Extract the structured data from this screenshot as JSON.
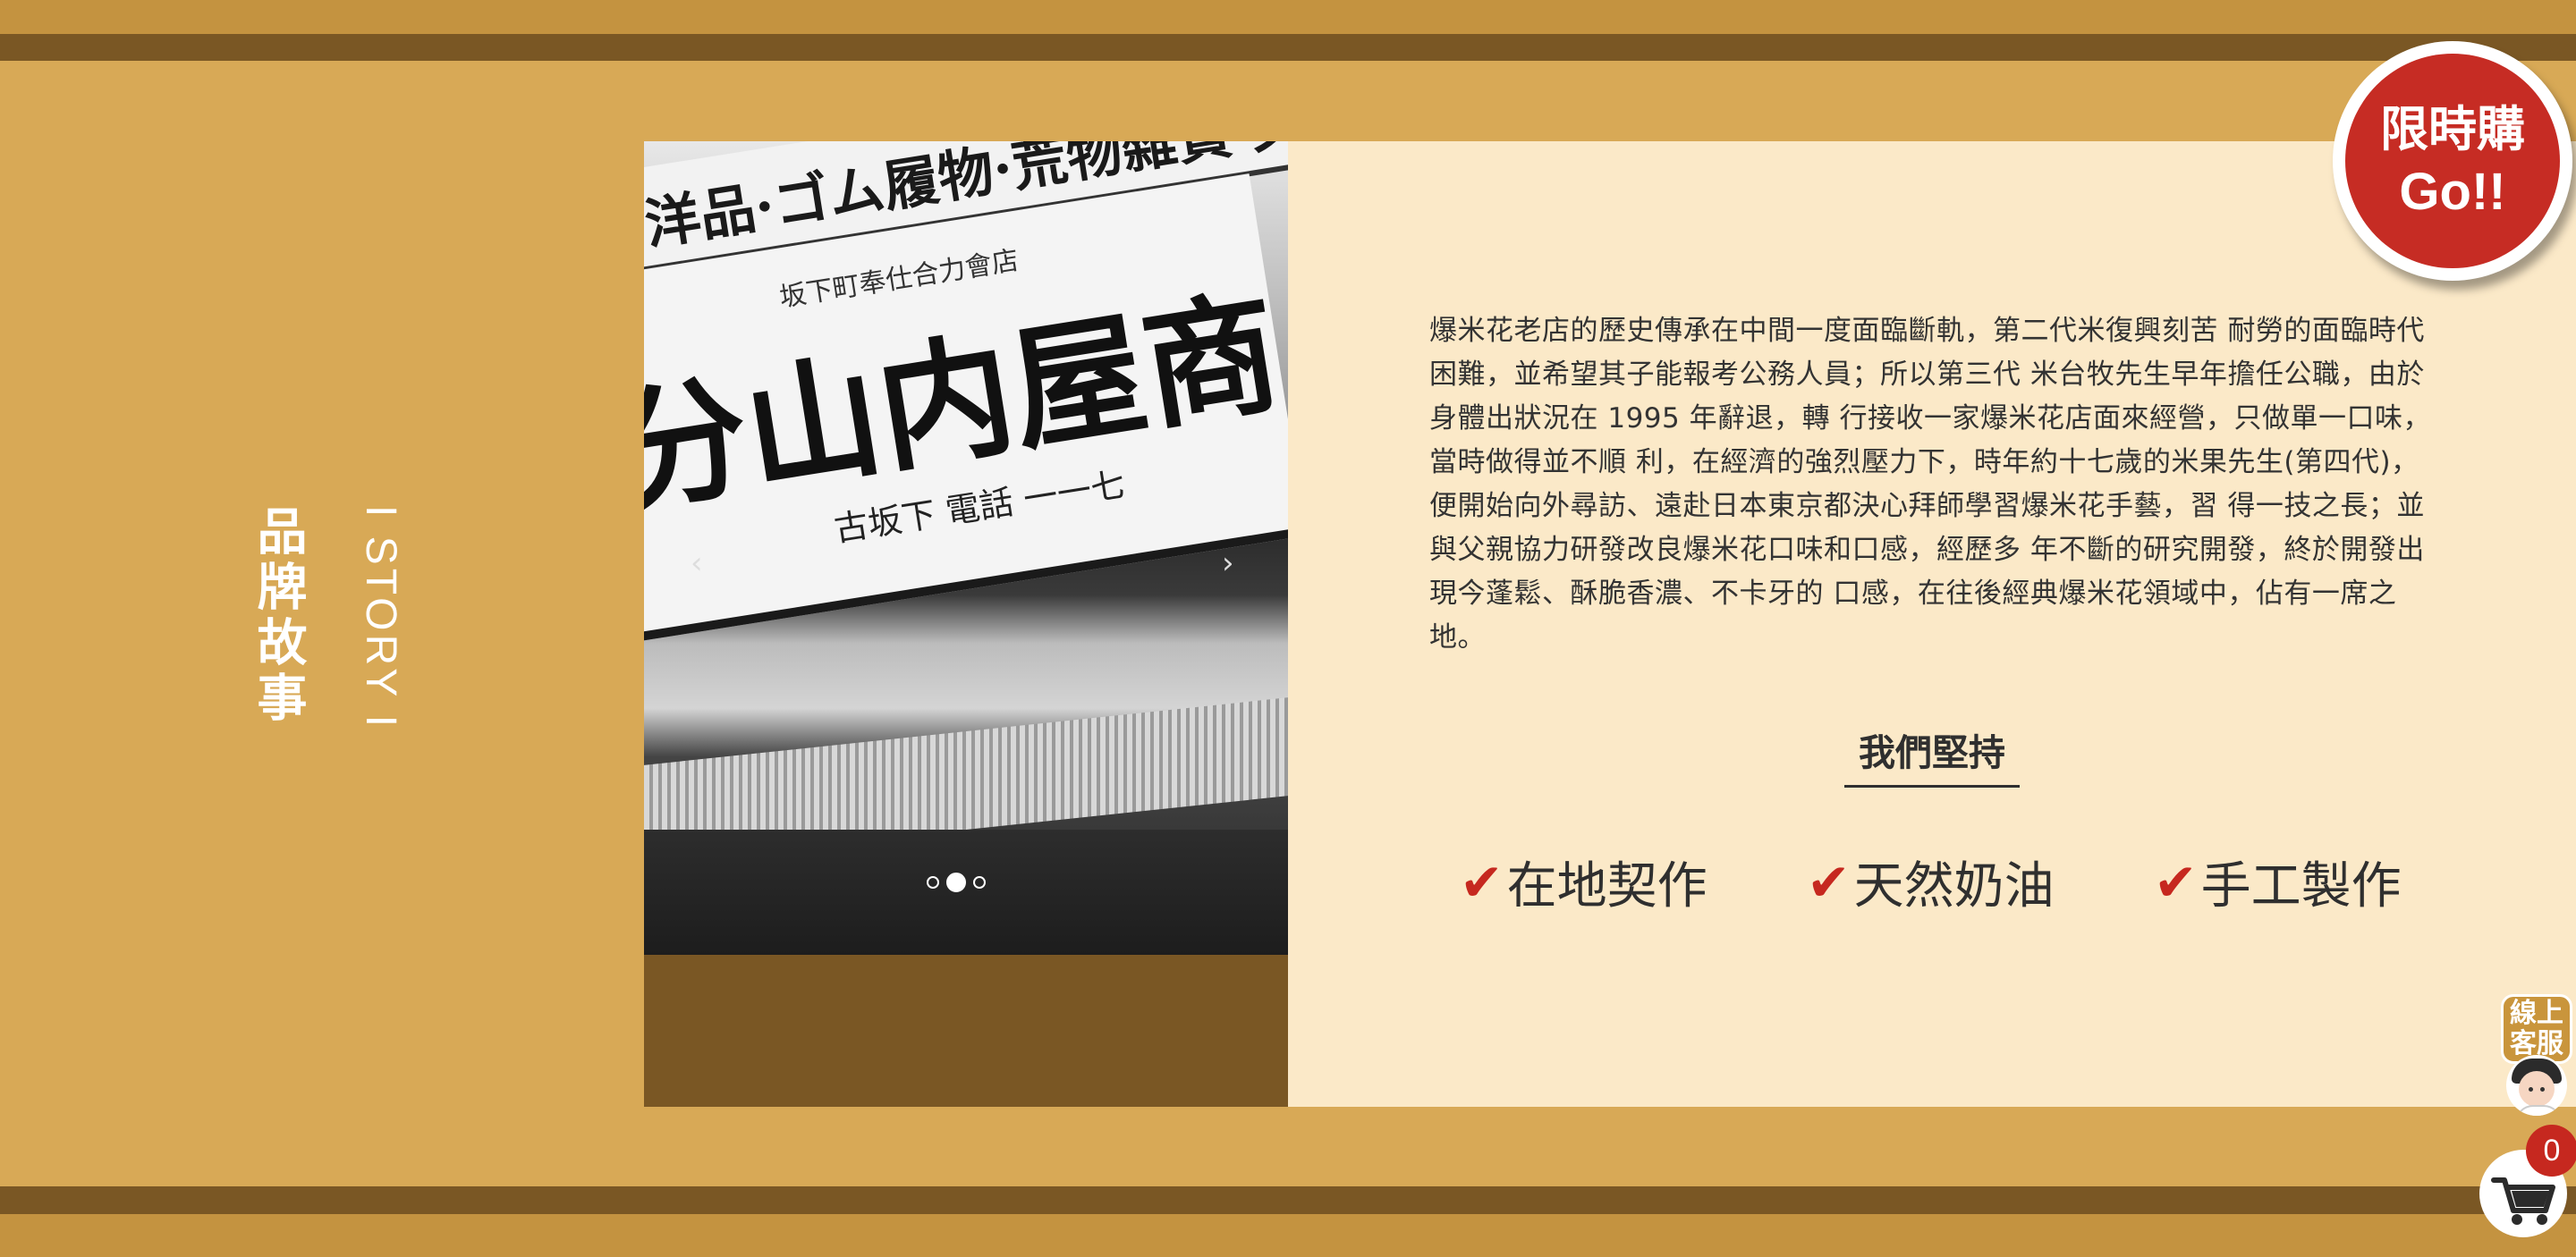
{
  "section": {
    "title_zh": "品牌故事",
    "title_en": "I STORY I"
  },
  "carousel": {
    "slide": {
      "sign_top_text": "洋品·ゴム履物·荒物雜貨·文",
      "sign_small_text": "坂下町奉仕合力會店",
      "sign_big_text": "分山内屋商",
      "sign_phone_text": "古坂下 電話 一一七"
    },
    "prev_label": "‹",
    "next_label": "›",
    "dots_count": 3,
    "active_dot": 2
  },
  "story": {
    "paragraph": "爆米花老店的歷史傳承在中間一度面臨斷軌，第二代米復興刻苦 耐勞的面臨時代困難，並希望其子能報考公務人員；所以第三代 米台牧先生早年擔任公職，由於身體出狀況在 1995 年辭退，轉 行接收一家爆米花店面來經營，只做單一口味，當時做得並不順 利，在經濟的強烈壓力下，時年約十七歲的米果先生(第四代)， 便開始向外尋訪、遠赴日本東京都決心拜師學習爆米花手藝，習 得一技之長；並與父親協力研發改良爆米花口味和口感，經歷多 年不斷的研究開發，終於開發出現今蓬鬆、酥脆香濃、不卡牙的 口感，在往後經典爆米花領域中，佔有一席之地。"
  },
  "commitment": {
    "heading": "我們堅持",
    "items": [
      {
        "check": "✔",
        "label": "在地契作"
      },
      {
        "check": "✔",
        "label": "天然奶油"
      },
      {
        "check": "✔",
        "label": "手工製作"
      }
    ]
  },
  "promo": {
    "line1": "限時購",
    "line2": "Go!!"
  },
  "support": {
    "label": "線上客服"
  },
  "cart": {
    "count": "0",
    "icon": "shopping-cart-icon"
  },
  "colors": {
    "background": "#d8a956",
    "band_dark": "#7a5724",
    "card": "#fbe9c8",
    "accent_red": "#c6281f"
  }
}
